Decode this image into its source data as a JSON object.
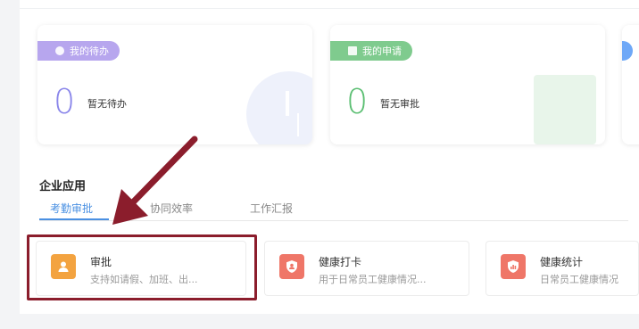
{
  "cards": {
    "todo": {
      "pill_label": "我的待办",
      "count": "0",
      "description": "暂无待办",
      "accent_color": "#b7a6ee",
      "pill_icon": "clock-circle-icon"
    },
    "apply": {
      "pill_label": "我的申请",
      "count": "0",
      "description": "暂无审批",
      "accent_color": "#7fcb8e",
      "pill_icon": "document-icon"
    }
  },
  "section": {
    "title": "企业应用",
    "tabs": [
      {
        "label": "考勤审批",
        "active": true
      },
      {
        "label": "协同效率",
        "active": false
      },
      {
        "label": "工作汇报",
        "active": false
      }
    ]
  },
  "apps": [
    {
      "name": "审批",
      "description": "支持如请假、加班、出...",
      "icon": "person-icon",
      "icon_color": "#f3a340"
    },
    {
      "name": "健康打卡",
      "description": "用于日常员工健康情况...",
      "icon": "shield-person-icon",
      "icon_color": "#ef7668"
    },
    {
      "name": "健康统计",
      "description": "日常员工健康情况",
      "icon": "shield-chart-icon",
      "icon_color": "#ef7668"
    }
  ],
  "annotation": {
    "arrow_color": "#8b1d2c",
    "highlight_target": "审批"
  }
}
